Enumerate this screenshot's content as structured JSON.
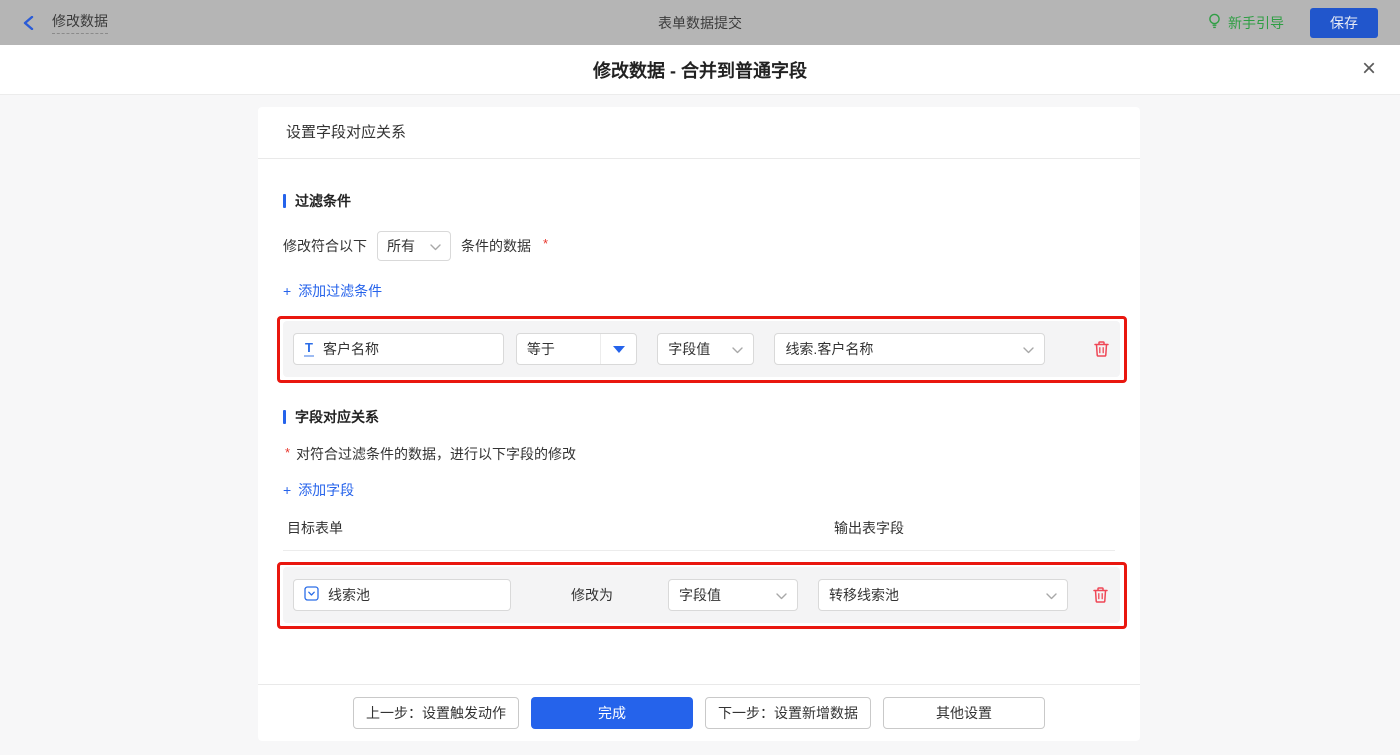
{
  "colors": {
    "accent_blue": "#2563eb",
    "topbar_gray": "#b5b5b5",
    "annotation_red": "#e9170f",
    "trash_red": "#ef4756",
    "guide_green": "#2f9e44",
    "row_bg": "#f4f4f5",
    "save_btn_blue": "#2156cc"
  },
  "topbar": {
    "back_label": "修改数据",
    "title": "表单数据提交",
    "guide_label": "新手引导",
    "save_label": "保存"
  },
  "modal": {
    "title": "修改数据 - 合并到普通字段",
    "close_glyph": "×"
  },
  "panel": {
    "header": "设置字段对应关系",
    "filter_section": {
      "title": "过滤条件",
      "cond_prefix": "修改符合以下",
      "match_mode": "所有",
      "cond_suffix": "条件的数据",
      "required_mark": "*",
      "add_icon": "+",
      "add_label": "添加过滤条件",
      "row": {
        "field": "客户名称",
        "field_icon": "T",
        "operator": "等于",
        "value_type": "字段值",
        "value": "线索.客户名称"
      }
    },
    "mapping_section": {
      "title": "字段对应关系",
      "required_mark": "*",
      "description": "对符合过滤条件的数据，进行以下字段的修改",
      "add_icon": "+",
      "add_label": "添加字段",
      "col_target": "目标表单",
      "col_output": "输出表字段",
      "row": {
        "field": "线索池",
        "action": "修改为",
        "value_type": "字段值",
        "value": "转移线索池"
      }
    },
    "footer": {
      "prev": "上一步：设置触发动作",
      "done": "完成",
      "next": "下一步：设置新增数据",
      "other": "其他设置"
    }
  }
}
